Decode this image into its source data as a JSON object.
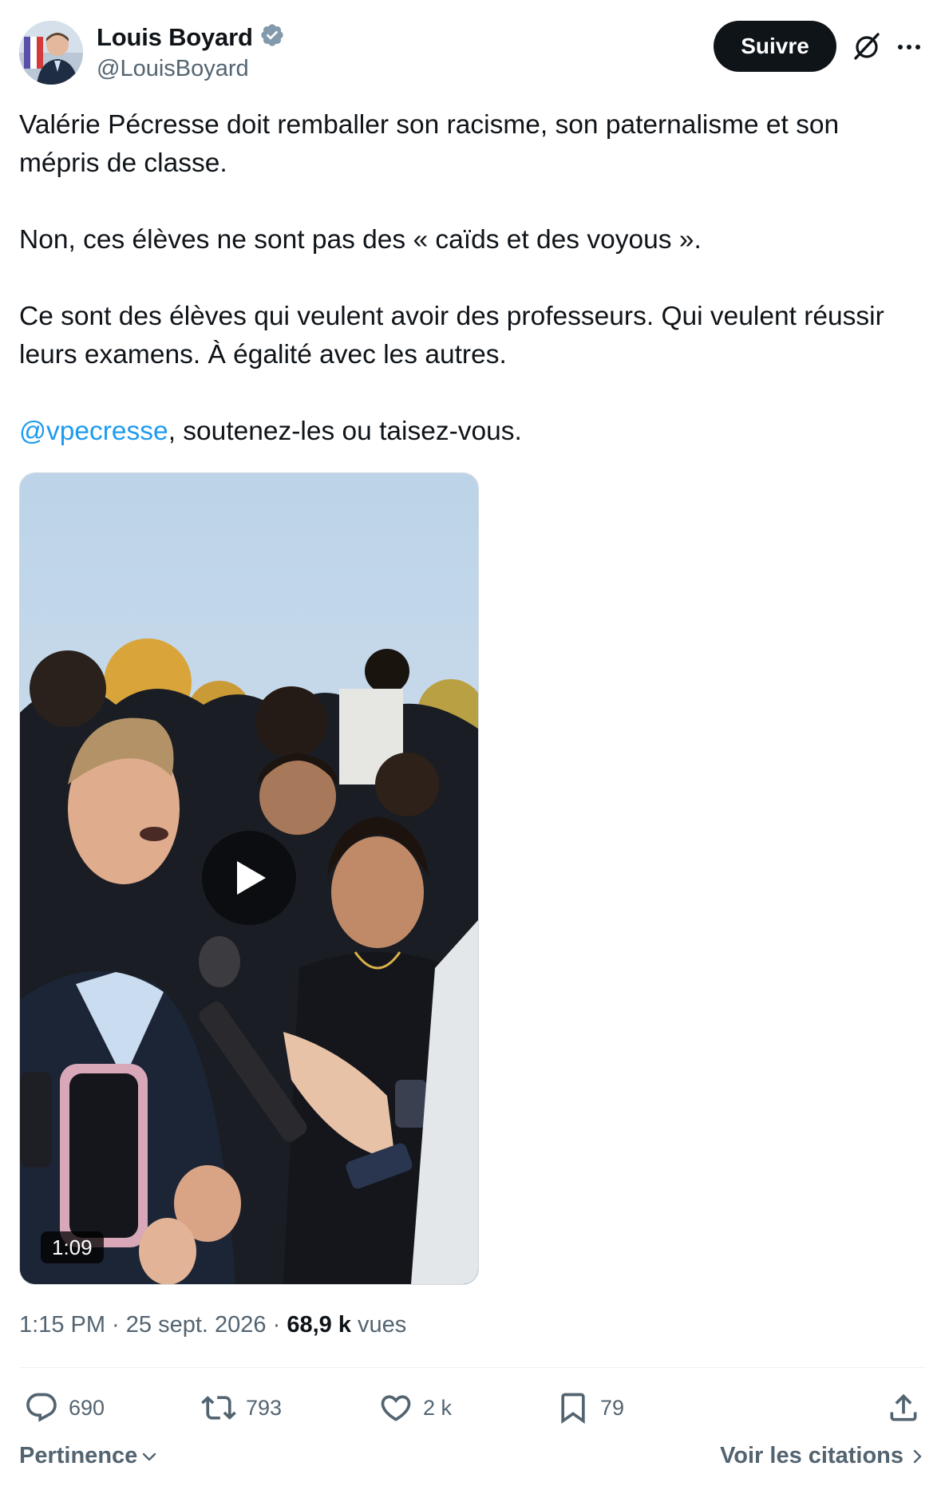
{
  "author": {
    "display_name": "Louis Boyard",
    "handle": "@LouisBoyard",
    "verified": true,
    "verified_color": "#829aab"
  },
  "header": {
    "follow_label": "Suivre",
    "icons": [
      "verified-badge-icon",
      "grok-icon",
      "more-icon"
    ]
  },
  "tweet": {
    "paragraph_1": "Valérie Pécresse doit remballer son racisme, son paternalisme et son mépris de classe.",
    "paragraph_2": "Non, ces élèves ne sont pas des « caïds et des voyous ».",
    "paragraph_3": "Ce sont des élèves qui veulent avoir des professeurs. Qui veulent réussir leurs examens. À égalité avec les autres.",
    "mention": "@vpecresse",
    "paragraph_4_rest": ", soutenez-les ou taisez-vous."
  },
  "media": {
    "type": "video",
    "duration": "1:09"
  },
  "meta": {
    "time": "1:15 PM",
    "separator": " · ",
    "date": "25 sept. 2026",
    "views_count": "68,9 k",
    "views_label": "vues"
  },
  "actions": {
    "replies": "690",
    "reposts": "793",
    "likes": "2 k",
    "bookmarks": "79"
  },
  "footer": {
    "sort_label": "Pertinence",
    "quotes_label": "Voir les citations"
  },
  "colors": {
    "text": "#0f1419",
    "secondary": "#536471",
    "accent": "#1d9bf0",
    "follow_bg": "#0f1419"
  }
}
